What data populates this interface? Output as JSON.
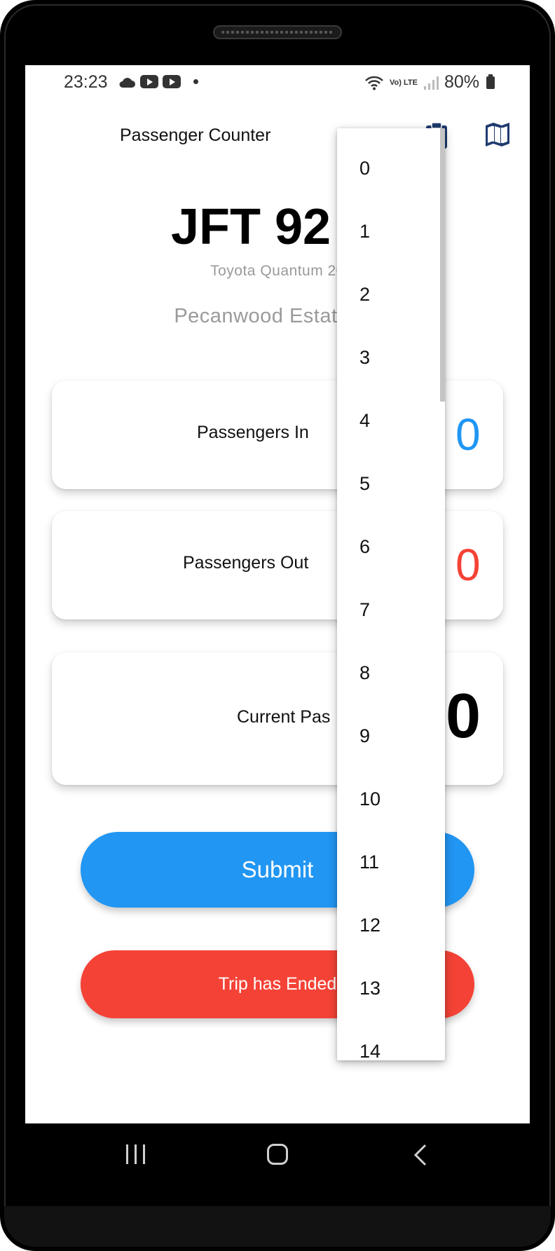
{
  "status_bar": {
    "time": "23:23",
    "network": "Vo) LTE",
    "battery": "80%"
  },
  "app_bar": {
    "title": "Passenger Counter",
    "icons": [
      "clipboard-icon",
      "map-icon"
    ]
  },
  "vehicle": {
    "plate": "JFT 92 G",
    "model": "Toyota Quantum 20",
    "route": "Pecanwood Estate  - F"
  },
  "counters": {
    "in_label": "Passengers In",
    "in_value": "0",
    "out_label": "Passengers Out",
    "out_value": "0",
    "current_label": "Current Pas",
    "current_value": "0"
  },
  "buttons": {
    "submit": "Submit",
    "trip_end": "Trip has Ended"
  },
  "dropdown": {
    "items": [
      "0",
      "1",
      "2",
      "3",
      "4",
      "5",
      "6",
      "7",
      "8",
      "9",
      "10",
      "11",
      "12",
      "13",
      "14"
    ]
  },
  "colors": {
    "accent_blue": "#2196f3",
    "accent_red": "#f44336",
    "icon_navy": "#1e3a6e"
  }
}
